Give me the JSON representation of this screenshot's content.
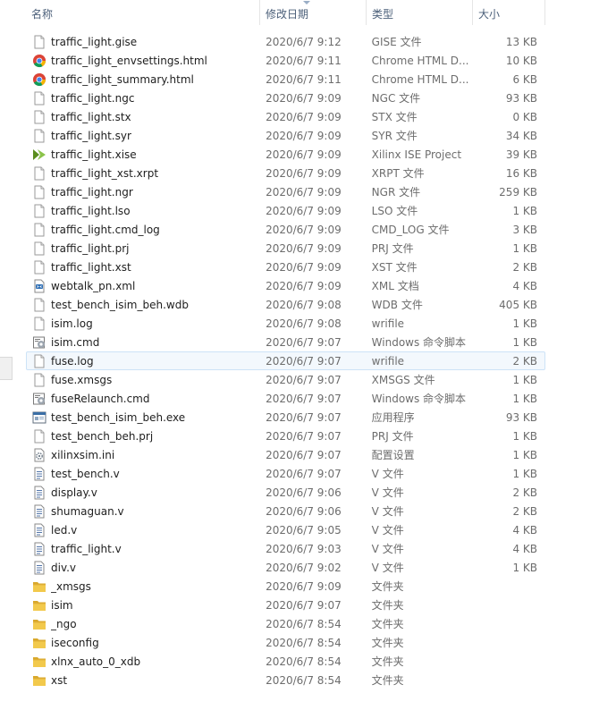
{
  "header": {
    "name": "名称",
    "date": "修改日期",
    "type": "类型",
    "size": "大小"
  },
  "files": [
    {
      "name": "traffic_light.gise",
      "date": "2020/6/7 9:12",
      "type": "GISE 文件",
      "size": "13 KB",
      "icon": "file-icon"
    },
    {
      "name": "traffic_light_envsettings.html",
      "date": "2020/6/7 9:11",
      "type": "Chrome HTML D...",
      "size": "10 KB",
      "icon": "chrome-icon"
    },
    {
      "name": "traffic_light_summary.html",
      "date": "2020/6/7 9:11",
      "type": "Chrome HTML D...",
      "size": "6 KB",
      "icon": "chrome-icon"
    },
    {
      "name": "traffic_light.ngc",
      "date": "2020/6/7 9:09",
      "type": "NGC 文件",
      "size": "93 KB",
      "icon": "file-icon"
    },
    {
      "name": "traffic_light.stx",
      "date": "2020/6/7 9:09",
      "type": "STX 文件",
      "size": "0 KB",
      "icon": "file-icon"
    },
    {
      "name": "traffic_light.syr",
      "date": "2020/6/7 9:09",
      "type": "SYR 文件",
      "size": "34 KB",
      "icon": "file-icon"
    },
    {
      "name": "traffic_light.xise",
      "date": "2020/6/7 9:09",
      "type": "Xilinx ISE Project",
      "size": "39 KB",
      "icon": "xilinx-icon"
    },
    {
      "name": "traffic_light_xst.xrpt",
      "date": "2020/6/7 9:09",
      "type": "XRPT 文件",
      "size": "16 KB",
      "icon": "file-icon"
    },
    {
      "name": "traffic_light.ngr",
      "date": "2020/6/7 9:09",
      "type": "NGR 文件",
      "size": "259 KB",
      "icon": "file-icon"
    },
    {
      "name": "traffic_light.lso",
      "date": "2020/6/7 9:09",
      "type": "LSO 文件",
      "size": "1 KB",
      "icon": "file-icon"
    },
    {
      "name": "traffic_light.cmd_log",
      "date": "2020/6/7 9:09",
      "type": "CMD_LOG 文件",
      "size": "3 KB",
      "icon": "file-icon"
    },
    {
      "name": "traffic_light.prj",
      "date": "2020/6/7 9:09",
      "type": "PRJ 文件",
      "size": "1 KB",
      "icon": "file-icon"
    },
    {
      "name": "traffic_light.xst",
      "date": "2020/6/7 9:09",
      "type": "XST 文件",
      "size": "2 KB",
      "icon": "file-icon"
    },
    {
      "name": "webtalk_pn.xml",
      "date": "2020/6/7 9:09",
      "type": "XML 文档",
      "size": "4 KB",
      "icon": "xml-icon"
    },
    {
      "name": "test_bench_isim_beh.wdb",
      "date": "2020/6/7 9:08",
      "type": "WDB 文件",
      "size": "405 KB",
      "icon": "file-icon"
    },
    {
      "name": "isim.log",
      "date": "2020/6/7 9:08",
      "type": "wrifile",
      "size": "1 KB",
      "icon": "file-icon"
    },
    {
      "name": "isim.cmd",
      "date": "2020/6/7 9:07",
      "type": "Windows 命令脚本",
      "size": "1 KB",
      "icon": "script-icon"
    },
    {
      "name": "fuse.log",
      "date": "2020/6/7 9:07",
      "type": "wrifile",
      "size": "2 KB",
      "icon": "file-icon",
      "selected": true
    },
    {
      "name": "fuse.xmsgs",
      "date": "2020/6/7 9:07",
      "type": "XMSGS 文件",
      "size": "1 KB",
      "icon": "file-icon"
    },
    {
      "name": "fuseRelaunch.cmd",
      "date": "2020/6/7 9:07",
      "type": "Windows 命令脚本",
      "size": "1 KB",
      "icon": "script-icon"
    },
    {
      "name": "test_bench_isim_beh.exe",
      "date": "2020/6/7 9:07",
      "type": "应用程序",
      "size": "93 KB",
      "icon": "exe-icon"
    },
    {
      "name": "test_bench_beh.prj",
      "date": "2020/6/7 9:07",
      "type": "PRJ 文件",
      "size": "1 KB",
      "icon": "file-icon"
    },
    {
      "name": "xilinxsim.ini",
      "date": "2020/6/7 9:07",
      "type": "配置设置",
      "size": "1 KB",
      "icon": "ini-icon"
    },
    {
      "name": "test_bench.v",
      "date": "2020/6/7 9:07",
      "type": "V 文件",
      "size": "1 KB",
      "icon": "verilog-icon"
    },
    {
      "name": "display.v",
      "date": "2020/6/7 9:06",
      "type": "V 文件",
      "size": "2 KB",
      "icon": "verilog-icon"
    },
    {
      "name": "shumaguan.v",
      "date": "2020/6/7 9:06",
      "type": "V 文件",
      "size": "2 KB",
      "icon": "verilog-icon"
    },
    {
      "name": "led.v",
      "date": "2020/6/7 9:05",
      "type": "V 文件",
      "size": "4 KB",
      "icon": "verilog-icon"
    },
    {
      "name": "traffic_light.v",
      "date": "2020/6/7 9:03",
      "type": "V 文件",
      "size": "4 KB",
      "icon": "verilog-icon"
    },
    {
      "name": "div.v",
      "date": "2020/6/7 9:02",
      "type": "V 文件",
      "size": "1 KB",
      "icon": "verilog-icon"
    },
    {
      "name": "_xmsgs",
      "date": "2020/6/7 9:09",
      "type": "文件夹",
      "size": "",
      "icon": "folder-icon"
    },
    {
      "name": "isim",
      "date": "2020/6/7 9:07",
      "type": "文件夹",
      "size": "",
      "icon": "folder-icon"
    },
    {
      "name": "_ngo",
      "date": "2020/6/7 8:54",
      "type": "文件夹",
      "size": "",
      "icon": "folder-icon"
    },
    {
      "name": "iseconfig",
      "date": "2020/6/7 8:54",
      "type": "文件夹",
      "size": "",
      "icon": "folder-icon"
    },
    {
      "name": "xlnx_auto_0_xdb",
      "date": "2020/6/7 8:54",
      "type": "文件夹",
      "size": "",
      "icon": "folder-icon"
    },
    {
      "name": "xst",
      "date": "2020/6/7 8:54",
      "type": "文件夹",
      "size": "",
      "icon": "folder-icon"
    }
  ],
  "colors": {
    "header_text": "#4c607a",
    "selection_bg": "#f3f8fd",
    "selection_border": "#cde3f7",
    "folder": "#e8c04a"
  }
}
